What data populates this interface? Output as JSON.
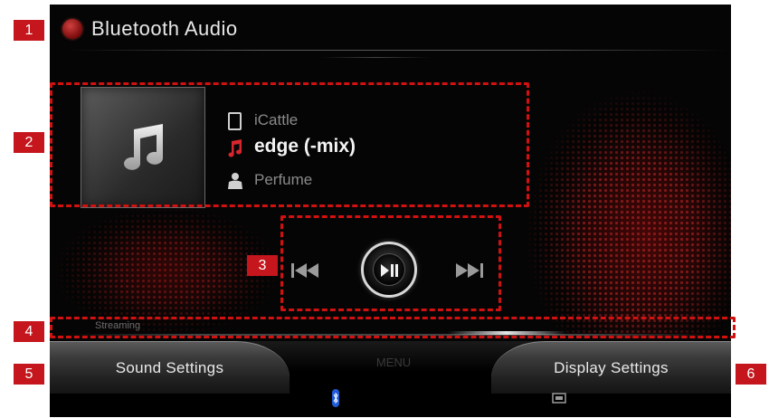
{
  "header": {
    "title": "Bluetooth Audio",
    "logo_icon": "kia-logo-icon"
  },
  "track": {
    "device": "iCattle",
    "song": "edge (-mix)",
    "artist": "Perfume",
    "album_art_icon": "music-note-icon",
    "device_icon": "phone-icon",
    "song_icon": "music-note-icon",
    "artist_icon": "person-icon"
  },
  "controls": {
    "prev_icon": "skip-previous-icon",
    "play_icon": "play-pause-icon",
    "next_icon": "skip-next-icon"
  },
  "status_bar": {
    "label": "Streaming"
  },
  "bottom": {
    "sound_settings": "Sound Settings",
    "menu": "MENU",
    "display_settings": "Display Settings",
    "bluetooth_icon": "bluetooth-icon",
    "aux_icon": "aux-icon"
  },
  "callouts": [
    "1",
    "2",
    "3",
    "4",
    "5",
    "6"
  ],
  "colors": {
    "accent": "#c4161c",
    "callout_border": "#d11010",
    "background": "#050505",
    "text_primary": "#f4f4f4",
    "text_secondary": "#8a8a8a"
  }
}
